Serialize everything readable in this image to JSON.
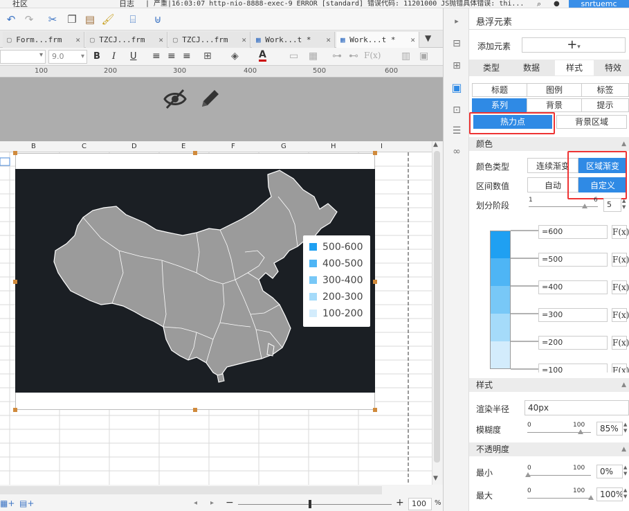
{
  "topbar": {
    "community": "社区",
    "log": "日志",
    "error_text": "| 严重|16:03:07 http-nio-8888-exec-9 ERROR [standard] 错误代码: 11201000 JS抛错具体错误: thi...",
    "user": "snrtuemc"
  },
  "tabs": [
    {
      "label": "Form...frm",
      "active": false
    },
    {
      "label": "TZCJ...frm",
      "active": false
    },
    {
      "label": "TZCJ...frm",
      "active": false
    },
    {
      "label": "Work...t *",
      "active": false
    },
    {
      "label": "Work...t *",
      "active": true
    }
  ],
  "toolbar2": {
    "font_size": "9.0",
    "bold": "B",
    "italic": "I",
    "underline": "U",
    "font_color": "A",
    "fx": "F(x)"
  },
  "ruler": {
    "marks": [
      "100",
      "200",
      "300",
      "400",
      "500",
      "600"
    ]
  },
  "columns": [
    "B",
    "C",
    "D",
    "E",
    "F",
    "G",
    "H",
    "I"
  ],
  "legend": {
    "items": [
      {
        "label": "500-600",
        "color": "#1fa0f2"
      },
      {
        "label": "400-500",
        "color": "#4eb5f5"
      },
      {
        "label": "300-400",
        "color": "#78c8f7"
      },
      {
        "label": "200-300",
        "color": "#a5dbfa"
      },
      {
        "label": "100-200",
        "color": "#d3ecfc"
      }
    ]
  },
  "bottom": {
    "zoom": "100",
    "percent": "%"
  },
  "panel": {
    "title": "悬浮元素",
    "add_element": "添加元素",
    "tabs": [
      "类型",
      "数据",
      "样式",
      "特效"
    ],
    "subtabs_row1": [
      "标题",
      "图例",
      "标签"
    ],
    "subtabs_row2": [
      "系列",
      "背景",
      "提示"
    ],
    "subtabs_row3": [
      "热力点",
      "背景区域"
    ],
    "color_section": "颜色",
    "color_type_label": "颜色类型",
    "color_type_options": [
      "连续渐变",
      "区域渐变"
    ],
    "interval_label": "区间数值",
    "interval_options": [
      "自动",
      "自定义"
    ],
    "stages_label": "划分阶段",
    "stages_min": "1",
    "stages_max": "6",
    "stages_value": "5",
    "ranges": [
      "=600",
      "=500",
      "=400",
      "=300",
      "=200",
      "=100"
    ],
    "fx": "F(x)",
    "style_section": "样式",
    "radius_label": "渲染半径",
    "radius_value": "40px",
    "blur_label": "模糊度",
    "blur_min": "0",
    "blur_max": "100",
    "blur_value": "85%",
    "opacity_section": "不透明度",
    "min_label": "最小",
    "min_min": "0",
    "min_max": "100",
    "min_value": "0%",
    "max_label": "最大",
    "max_min": "0",
    "max_max": "100",
    "max_value": "100%"
  },
  "colors": {
    "accent": "#2f8ae5",
    "map_bg": "#1b1f24",
    "map_fill": "#9a9a9a",
    "highlight_box": "#e33333"
  }
}
